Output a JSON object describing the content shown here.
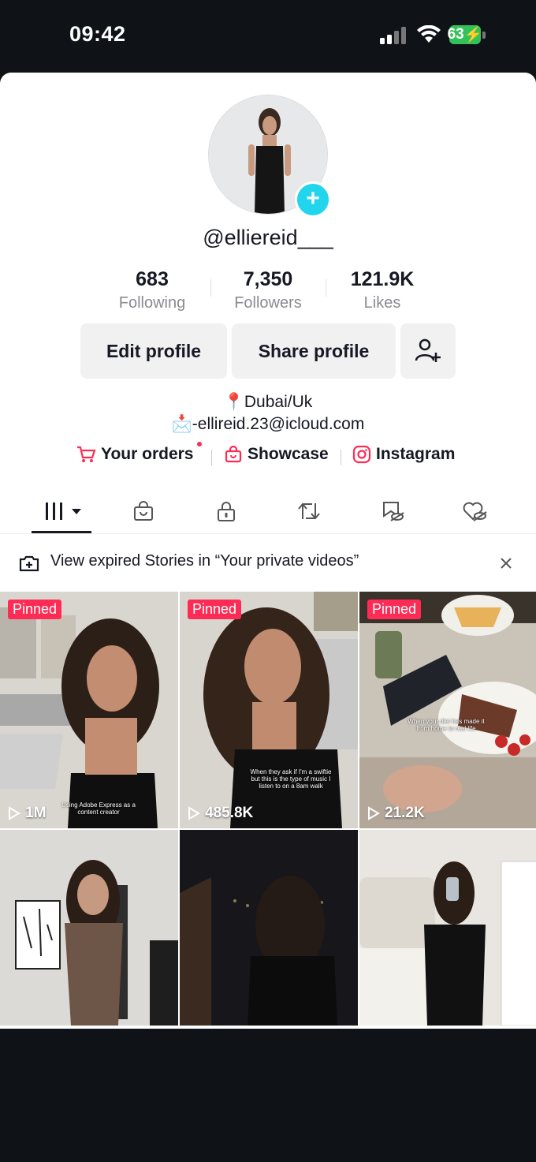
{
  "status_bar": {
    "time": "09:42",
    "battery": "63"
  },
  "profile": {
    "username": "@elliereid___",
    "stats": [
      {
        "value": "683",
        "label": "Following"
      },
      {
        "value": "7,350",
        "label": "Followers"
      },
      {
        "value": "121.9K",
        "label": "Likes"
      }
    ],
    "buttons": {
      "edit": "Edit profile",
      "share": "Share profile"
    },
    "bio": {
      "location": "Dubai/Uk",
      "email": "-ellireid.23@icloud.com"
    },
    "links": {
      "orders": "Your orders",
      "showcase": "Showcase",
      "instagram": "Instagram"
    }
  },
  "banner": {
    "text": "View expired Stories in “Your private videos”"
  },
  "videos": [
    {
      "badge": "Pinned",
      "views": "1M",
      "caption": "Using Adobe Express as a content creator"
    },
    {
      "badge": "Pinned",
      "views": "485.8K",
      "caption": "When they ask if I'm a swiftie but this is the type of music I listen to on a 8am walk"
    },
    {
      "badge": "Pinned",
      "views": "21.2K",
      "caption": "When your diet has made it from home to real life"
    },
    {
      "badge": "",
      "views": "",
      "caption": ""
    },
    {
      "badge": "",
      "views": "",
      "caption": ""
    },
    {
      "badge": "",
      "views": "",
      "caption": ""
    }
  ],
  "colors": {
    "accent": "#fe2c55",
    "avatar_plus": "#20d5ec",
    "battery": "#33c25a"
  }
}
